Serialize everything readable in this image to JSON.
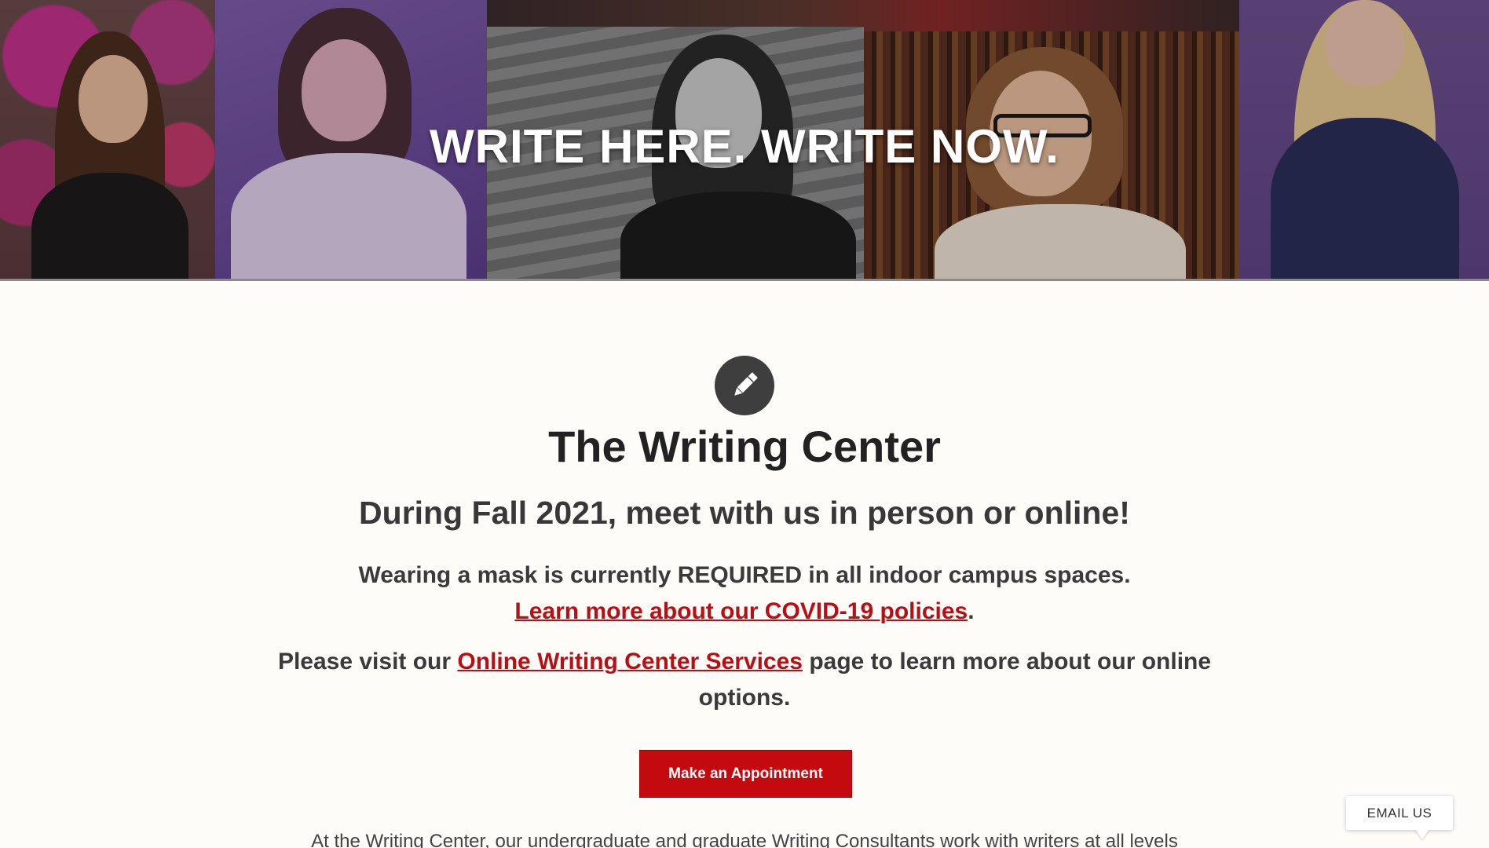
{
  "hero": {
    "title": "WRITE HERE. WRITE NOW.",
    "photos": [
      "portrait-flowers",
      "portrait-purple",
      "portrait-bw",
      "portrait-library",
      "portrait-blonde"
    ]
  },
  "main": {
    "icon": "pencil-icon",
    "title": "The Writing Center",
    "subtitle": "During Fall 2021, meet with us in person or online!",
    "mask_notice": "Wearing a mask is currently REQUIRED in all indoor campus spaces.",
    "covid_link": "Learn more about our COVID-19 policies",
    "covid_suffix": ".",
    "online_prefix": "Please visit our ",
    "online_link": "Online Writing Center Services",
    "online_suffix": " page to learn more about our online options.",
    "appointment_button": "Make an Appointment",
    "intro_text": "At the Writing Center, our undergraduate and graduate Writing Consultants work with writers at all levels"
  },
  "widget": {
    "email_label": "EMAIL US"
  },
  "colors": {
    "accent": "#c4090f",
    "link": "#b80f14",
    "background": "#fdfcf9",
    "text": "#2b2b2b"
  }
}
